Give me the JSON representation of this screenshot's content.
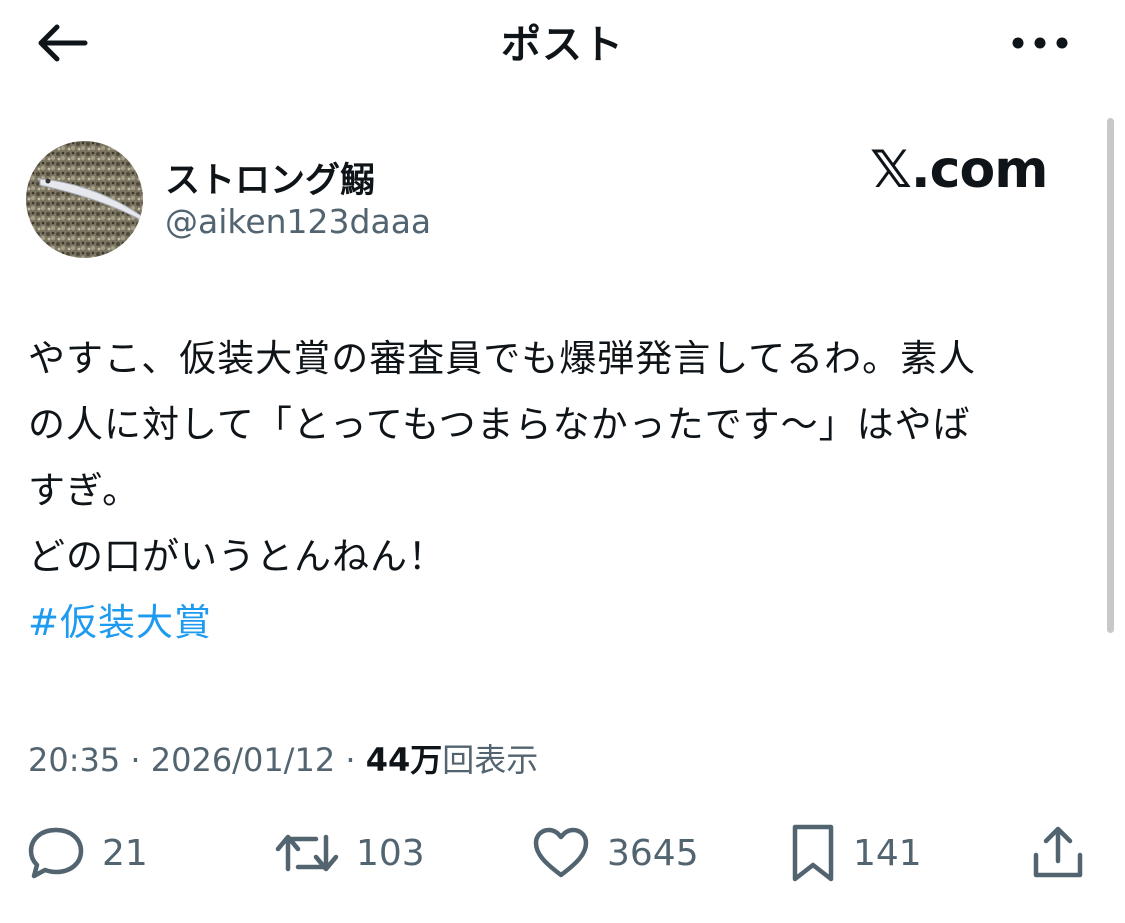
{
  "header": {
    "back_icon": "arrow-left-icon",
    "title": "ポスト",
    "more_icon": "more-horizontal-icon"
  },
  "author": {
    "avatar": "fish-photo-avatar",
    "name": "ストロング鰯",
    "handle": "@aiken123daaa"
  },
  "brand": "𝕏.com",
  "post": {
    "lines": [
      "やすこ、仮装大賞の審査員でも爆弾発言してるわ。素人",
      "の人に対して「とってもつまらなかったです〜」はやば",
      "すぎ。",
      "どの口がいうとんねん！"
    ],
    "hashtag": "#仮装大賞"
  },
  "meta": {
    "time": "20:35",
    "separator": " · ",
    "date": "2026/01/12",
    "views_count": "44万",
    "views_label": "回表示"
  },
  "actions": {
    "replies": "21",
    "reposts": "103",
    "likes": "3645",
    "bookmarks": "141"
  },
  "colors": {
    "text": "#0f1419",
    "secondary": "#536471",
    "link": "#1d9bf0"
  }
}
